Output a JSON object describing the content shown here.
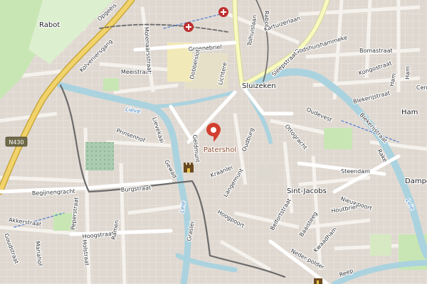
{
  "map": {
    "districts": [
      "Rabot",
      "Sluizeken",
      "Sint-Jacobs",
      "Ham",
      "Dampoort"
    ],
    "poi": {
      "name": "Patershol",
      "marker_color": "#d23f2f"
    },
    "water": [
      "Lieve",
      "Leie"
    ],
    "road_shield": "N430",
    "streets": {
      "opgeeisten": "Opgeëis",
      "kolveniersgang": "Kolveniersgang",
      "meeistraat": "Meeistraat",
      "molenaarsstraat": "Molenaarsstraat",
      "groenebriel": "Groenebriel",
      "dobbelslot": "Dobbelslot",
      "lichtere": "Lichtere",
      "tolhuislaan": "Tolhuislaan",
      "kartuizerlaan": "Kartuizerlaan",
      "godshuishammeke": "Godshuishammeke",
      "bomastraat": "Bomastraat",
      "kongostraat": "Kongostraat",
      "sleepstraat": "Sleepstraat",
      "rabot_top": "Rabot",
      "ham_v1": "Ham",
      "ham_v2": "Ham",
      "blekerijstraat": "Blekerijstraat",
      "oudevest": "Oudevest",
      "ottogracht": "Ottogracht",
      "oudburg": "Oudburg",
      "blekerijstraat2": "Blekerijstraat",
      "rake": "Rake",
      "lievekaai": "Lievekaai",
      "prinsenhof": "Prinsenhof",
      "geldmunt": "Geldmunt",
      "gewad": "Gewad",
      "kraanlei": "Kraanlei",
      "langemunt": "Langemunt",
      "steendam": "Steendam",
      "beijingengracht": "Begijnengracht",
      "burgstraat": "Burgstraat",
      "akkerstraat": "Akkerstraat",
      "peperstraat": "Peperstraat",
      "hoogstraat": "Hoogstraat",
      "ramen": "Ramen",
      "graslei": "Graslei",
      "hoogpoort": "Hoogpoort",
      "belfortstraat": "Belfortstraat",
      "baaisteeg": "Baaisteeg",
      "nieuwpoort": "Nieuwpoort",
      "houtbriel": "Houtbriel",
      "kwaadham": "Kwaadham",
      "nederpolder": "Neder-polder",
      "leie_right": "Leie",
      "goudstraat": "Goudstraat",
      "mariahof": "Mariahof",
      "holstraat": "Holstraat",
      "reep": "Reep",
      "cen": "Cen"
    },
    "colors": {
      "background": "#f2efe9",
      "building": "#d9d0c9",
      "water": "#aad3df",
      "park": "#c8e6b4",
      "major_road": "#ffffff",
      "primary_road": "#f7fabf",
      "rail": "#7a7a7a",
      "tram": "#555555",
      "motorway": "#e2c35c",
      "hospital": "#bd2f2f"
    }
  }
}
